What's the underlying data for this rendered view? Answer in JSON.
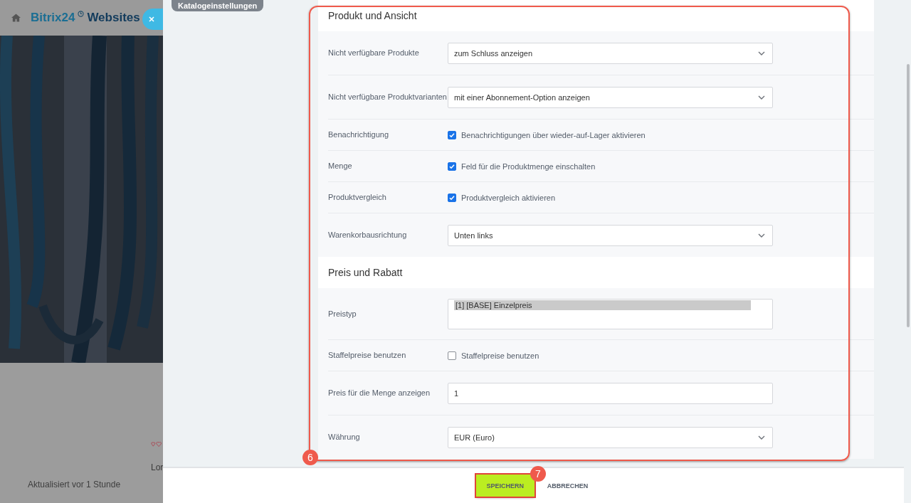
{
  "site": {
    "brand": "Bitrix24",
    "brand_suffix": "Websites",
    "text_fragment": "Lor",
    "updated": "Aktualisiert vor 1 Stunde"
  },
  "panel": {
    "tag": "Katalogeinstellungen",
    "sections": [
      {
        "title": "Produkt und Ansicht",
        "rows": [
          {
            "kind": "select",
            "label": "Nicht verfügbare Produkte",
            "value": "zum Schluss anzeigen"
          },
          {
            "kind": "select",
            "label": "Nicht verfügbare Produktvarianten",
            "value": "mit einer Abonnement-Option anzeigen"
          },
          {
            "kind": "checkbox",
            "label": "Benachrichtigung",
            "text": "Benachrichtigungen über wieder-auf-Lager aktivieren",
            "checked": true
          },
          {
            "kind": "checkbox",
            "label": "Menge",
            "text": "Feld für die Produktmenge einschalten",
            "checked": true
          },
          {
            "kind": "checkbox",
            "label": "Produktvergleich",
            "text": "Produktvergleich aktivieren",
            "checked": true
          },
          {
            "kind": "select",
            "label": "Warenkorbausrichtung",
            "value": "Unten links"
          }
        ]
      },
      {
        "title": "Preis und Rabatt",
        "rows": [
          {
            "kind": "listbox",
            "label": "Preistyp",
            "options": [
              {
                "text": "[1] [BASE] Einzelpreis",
                "selected": true
              }
            ]
          },
          {
            "kind": "checkbox",
            "label": "Staffelpreise benutzen",
            "text": "Staffelpreise benutzen",
            "checked": false
          },
          {
            "kind": "input",
            "label": "Preis für die Menge anzeigen",
            "value": "1"
          },
          {
            "kind": "select",
            "label": "Währung",
            "value": "EUR (Euro)"
          }
        ]
      }
    ]
  },
  "footer": {
    "buttons": [
      {
        "kind": "primary",
        "label": "SPEICHERN"
      },
      {
        "kind": "link",
        "label": "ABBRECHEN"
      }
    ]
  },
  "annotations": [
    {
      "number": "6"
    },
    {
      "number": "7"
    }
  ]
}
